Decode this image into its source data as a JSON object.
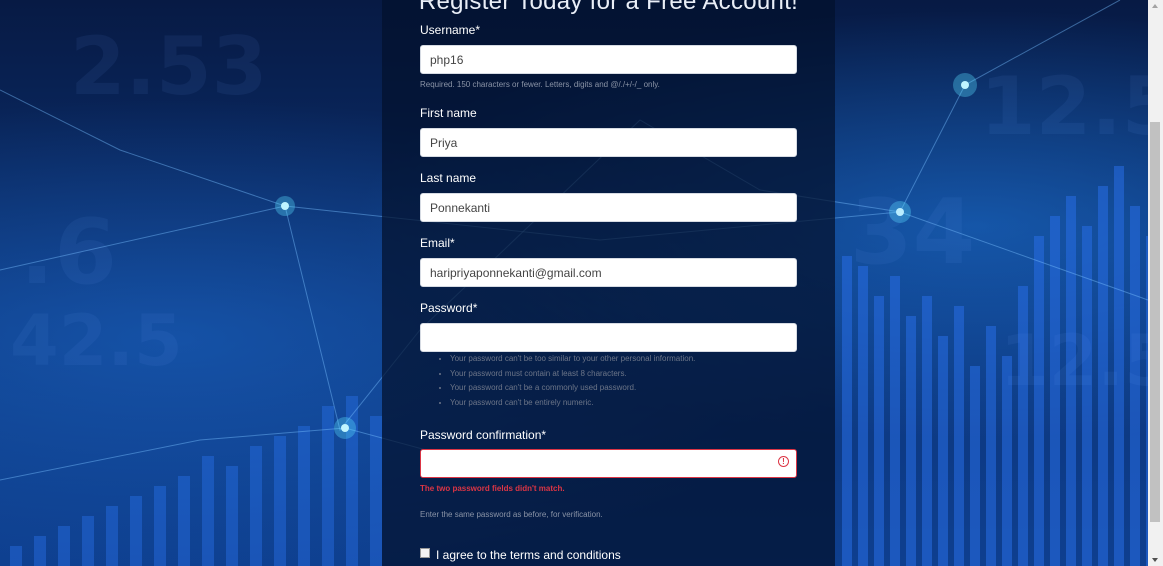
{
  "form": {
    "title": "Register Today for a Free Account!",
    "username": {
      "label": "Username*",
      "value": "php16",
      "help": "Required. 150 characters or fewer. Letters, digits and @/./+/-/_ only."
    },
    "first_name": {
      "label": "First name",
      "value": "Priya"
    },
    "last_name": {
      "label": "Last name",
      "value": "Ponnekanti"
    },
    "email": {
      "label": "Email*",
      "value": "haripriyaponnekanti@gmail.com"
    },
    "password": {
      "label": "Password*",
      "value": "",
      "rules": [
        "Your password can't be too similar to your other personal information.",
        "Your password must contain at least 8 characters.",
        "Your password can't be a commonly used password.",
        "Your password can't be entirely numeric."
      ]
    },
    "password_confirmation": {
      "label": "Password confirmation*",
      "value": "",
      "error": "The two password fields didn't match.",
      "help": "Enter the same password as before, for verification.",
      "error_icon": "exclamation-circle-icon"
    },
    "terms_label": "I agree to the terms and conditions"
  },
  "colors": {
    "panel": "#03102d",
    "error": "#dc3545",
    "background": "#0c3478"
  }
}
